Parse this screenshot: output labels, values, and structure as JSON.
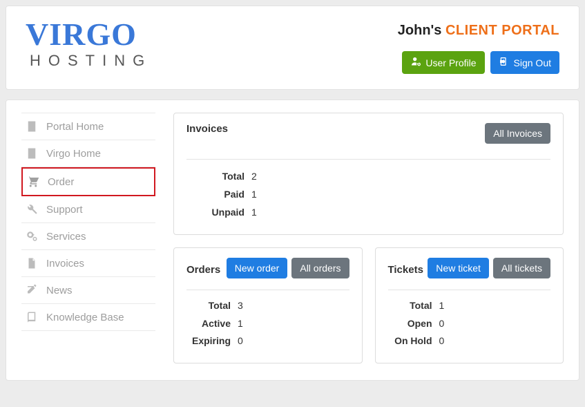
{
  "logo": {
    "main": "VIRGO",
    "sub": "HOSTING"
  },
  "header": {
    "user": "John's",
    "portal": "CLIENT PORTAL",
    "profile_btn": "User Profile",
    "signout_btn": "Sign Out"
  },
  "sidebar": {
    "items": [
      {
        "icon": "building-icon",
        "label": "Portal Home",
        "active": false
      },
      {
        "icon": "building-icon",
        "label": "Virgo Home",
        "active": false
      },
      {
        "icon": "cart-icon",
        "label": "Order",
        "active": true
      },
      {
        "icon": "wrench-icon",
        "label": "Support",
        "active": false
      },
      {
        "icon": "gears-icon",
        "label": "Services",
        "active": false
      },
      {
        "icon": "file-icon",
        "label": "Invoices",
        "active": false
      },
      {
        "icon": "edit-icon",
        "label": "News",
        "active": false
      },
      {
        "icon": "book-icon",
        "label": "Knowledge Base",
        "active": false
      }
    ]
  },
  "invoices": {
    "title": "Invoices",
    "all_btn": "All Invoices",
    "stats": {
      "total_label": "Total",
      "total_val": "2",
      "paid_label": "Paid",
      "paid_val": "1",
      "unpaid_label": "Unpaid",
      "unpaid_val": "1"
    }
  },
  "orders": {
    "title": "Orders",
    "new_btn": "New order",
    "all_btn": "All orders",
    "stats": {
      "total_label": "Total",
      "total_val": "3",
      "active_label": "Active",
      "active_val": "1",
      "expiring_label": "Expiring",
      "expiring_val": "0"
    }
  },
  "tickets": {
    "title": "Tickets",
    "new_btn": "New ticket",
    "all_btn": "All tickets",
    "stats": {
      "total_label": "Total",
      "total_val": "1",
      "open_label": "Open",
      "open_val": "0",
      "onhold_label": "On Hold",
      "onhold_val": "0"
    }
  }
}
